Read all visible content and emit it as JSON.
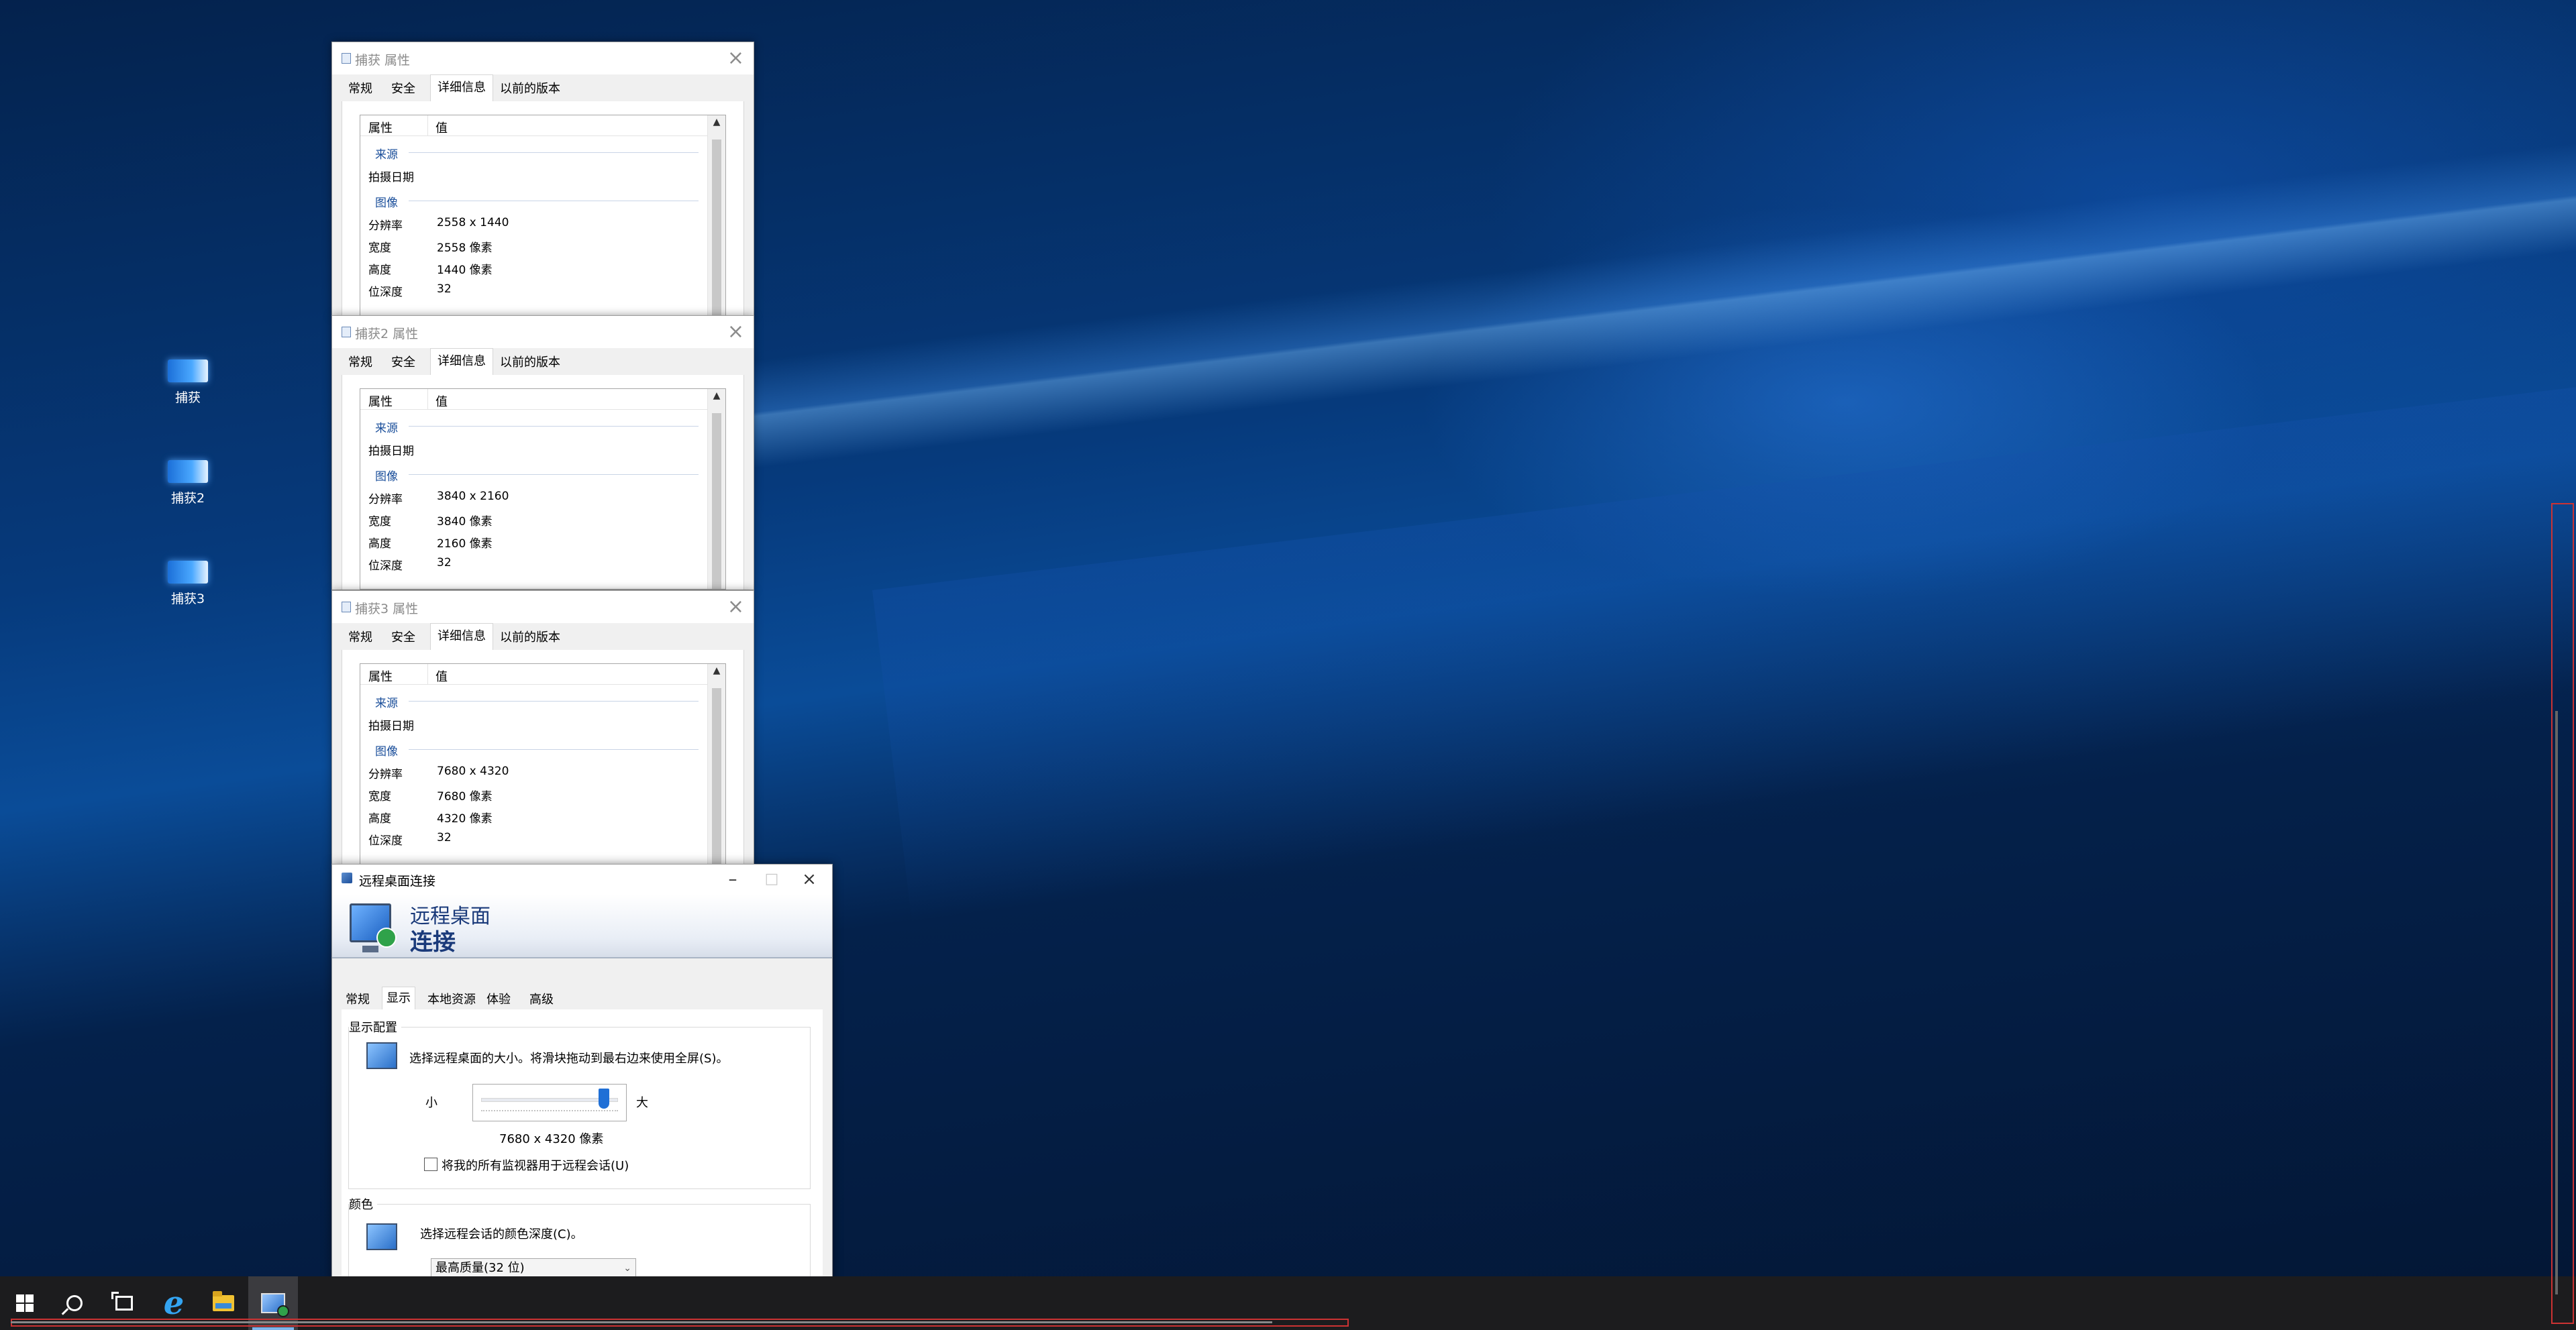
{
  "desktop_icons": [
    {
      "label": "捕获"
    },
    {
      "label": "捕获2"
    },
    {
      "label": "捕获3"
    }
  ],
  "prop_tabs": [
    "常规",
    "安全",
    "详细信息",
    "以前的版本"
  ],
  "prop_header": {
    "property": "属性",
    "value": "值"
  },
  "prop_groups": {
    "source": "来源",
    "image": "图像"
  },
  "prop_labels": {
    "date_taken": "拍摄日期",
    "resolution": "分辨率",
    "width": "宽度",
    "height": "高度",
    "bit_depth": "位深度"
  },
  "properties": [
    {
      "title": "捕获 属性",
      "resolution": "2558 x 1440",
      "width": "2558 像素",
      "height": "1440 像素",
      "bit_depth": "32"
    },
    {
      "title": "捕获2 属性",
      "resolution": "3840 x 2160",
      "width": "3840 像素",
      "height": "2160 像素",
      "bit_depth": "32"
    },
    {
      "title": "捕获3 属性",
      "resolution": "7680 x 4320",
      "width": "7680 像素",
      "height": "4320 像素",
      "bit_depth": "32"
    }
  ],
  "rdc": {
    "title": "远程桌面连接",
    "banner_line1": "远程桌面",
    "banner_line2": "连接",
    "tabs": [
      "常规",
      "显示",
      "本地资源",
      "体验",
      "高级"
    ],
    "display_group": "显示配置",
    "display_text": "选择远程桌面的大小。将滑块拖动到最右边来使用全屏(S)。",
    "slider_small": "小",
    "slider_large": "大",
    "slider_value": 0.93,
    "resolution_text": "7680 x 4320 像素",
    "all_monitors": "将我的所有监视器用于远程会话(U)",
    "all_monitors_checked": false,
    "color_group": "颜色",
    "color_text": "选择远程会话的颜色深度(C)。",
    "color_selected": "最高质量(32 位)"
  },
  "taskbar": {
    "items": [
      "start-icon",
      "search-icon",
      "task-view-icon",
      "internet-explorer-icon",
      "file-explorer-icon",
      "remote-desktop-icon"
    ]
  },
  "colors": {
    "accent": "#1f6fd6",
    "taskbar": "#1c1c1e",
    "group_text": "#1a4e9a"
  }
}
